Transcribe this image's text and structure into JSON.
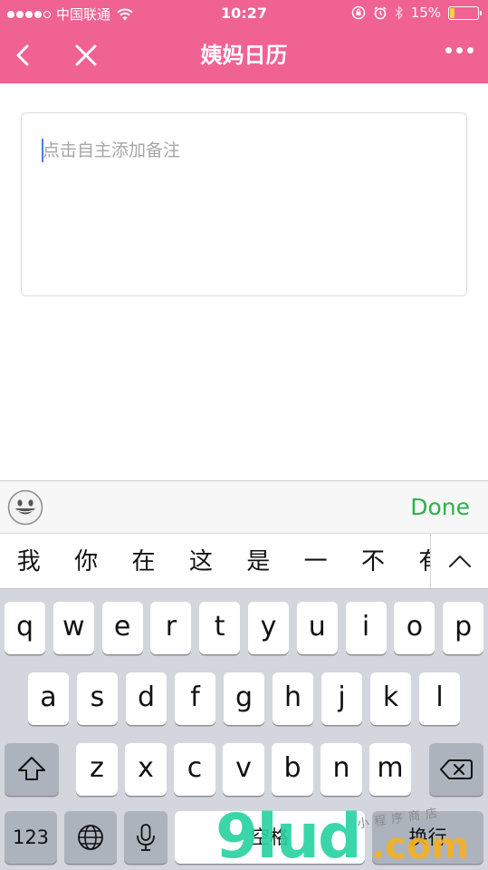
{
  "status_bar": {
    "carrier": "中国联通",
    "time": "10:27",
    "battery_percent": "15%",
    "battery_level": 0.15,
    "battery_color": "#f7d23c"
  },
  "nav": {
    "title": "姨妈日历",
    "back_icon": "chevron-left-icon",
    "close_icon": "close-icon",
    "more_icon": "more-dots-icon",
    "background_color": "#f06292"
  },
  "note": {
    "value": "",
    "placeholder": "点击自主添加备注"
  },
  "accessory": {
    "emoji_icon": "emoji-icon",
    "done_label": "Done",
    "done_color": "#2ab348"
  },
  "candidates": {
    "items": [
      "我",
      "你",
      "在",
      "这",
      "是",
      "一",
      "不",
      "有"
    ],
    "expand_icon": "chevron-up-icon"
  },
  "keyboard": {
    "row1": [
      "q",
      "w",
      "e",
      "r",
      "t",
      "y",
      "u",
      "i",
      "o",
      "p"
    ],
    "row2": [
      "a",
      "s",
      "d",
      "f",
      "g",
      "h",
      "j",
      "k",
      "l"
    ],
    "row3": [
      "z",
      "x",
      "c",
      "v",
      "b",
      "n",
      "m"
    ],
    "numbers_label": "123",
    "space_label": "空格",
    "return_label": "换行"
  },
  "watermark": {
    "brand": "9lud",
    "domain": ".com",
    "tagline": "小程序商店"
  }
}
